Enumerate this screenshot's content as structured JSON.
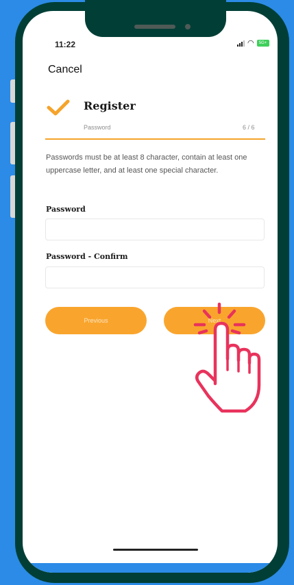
{
  "status_bar": {
    "time": "11:22",
    "battery": "5G+"
  },
  "nav": {
    "cancel_label": "Cancel"
  },
  "header": {
    "title": "Register",
    "step_label": "Password",
    "step_count": "6 / 6"
  },
  "instructions": "Passwords must be at least 8 character, contain at least one uppercase letter, and at least one special character.",
  "form": {
    "password_label": "Password",
    "password_value": "",
    "confirm_label": "Password - Confirm",
    "confirm_value": ""
  },
  "buttons": {
    "previous_label": "Previous",
    "next_label": "Next"
  },
  "colors": {
    "accent": "#f9a52d",
    "phone_frame": "#013f36",
    "background": "#2b8be6",
    "hand": "#e8335c"
  },
  "icons": [
    "check-icon",
    "signal-icon",
    "wifi-icon",
    "battery-icon",
    "tap-hand-icon"
  ]
}
